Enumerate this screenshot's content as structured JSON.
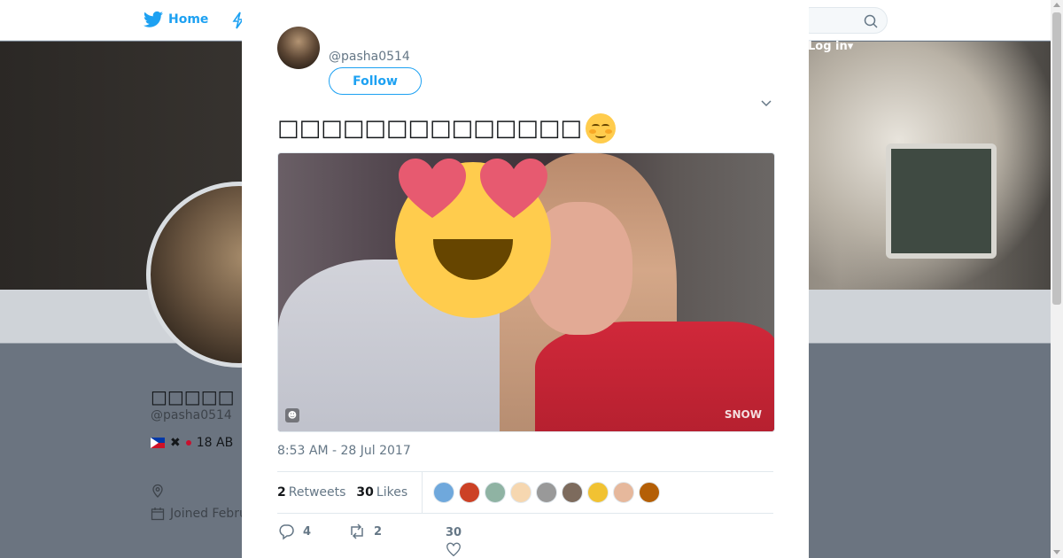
{
  "topbar": {
    "home_label": "Home",
    "login_label": "Log in"
  },
  "profile": {
    "display_name": "□□□□□",
    "handle": "@pasha0514",
    "bio_age": "18 AB",
    "joined_label": "Joined Febru"
  },
  "modal": {
    "handle": "@pasha0514",
    "follow_label": "Follow",
    "tweet_text": "□□□□□□□□□□□□□□",
    "photo_watermark": "SNOW",
    "timestamp": "8:53 AM - 28 Jul 2017",
    "stats": {
      "retweets_count": "2",
      "retweets_label": "Retweets",
      "likes_count": "30",
      "likes_label": "Likes"
    },
    "likers": [
      "#6fa8dc",
      "#cc4125",
      "#8fb3a3",
      "#f6d7b0",
      "#999999",
      "#7d6b5d",
      "#f1c232",
      "#e6b89c",
      "#b45f06"
    ],
    "actions": {
      "reply_count": "4",
      "retweet_count": "2",
      "like_count": "30"
    }
  },
  "colors": {
    "accent": "#1da1f2",
    "overlay": "#6b7480"
  }
}
